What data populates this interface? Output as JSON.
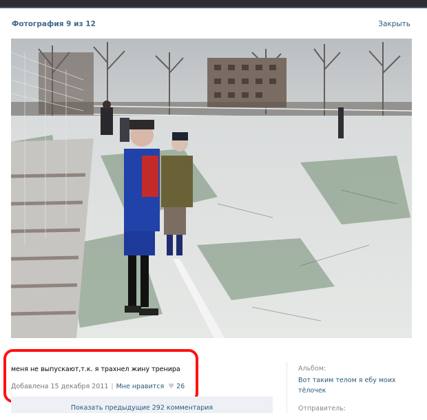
{
  "header": {
    "title": "Фотография 9 из 12",
    "close_label": "Закрыть"
  },
  "photo": {
    "alt_subject": "children-on-snowy-football-field"
  },
  "caption": {
    "text": "меня не выпускают,т.к. я трахнел жину тренира",
    "added_label": "Добавлена 15 декабря 2011",
    "like_label": "Мне нравится",
    "likes_count": "26"
  },
  "side": {
    "album_label": "Альбом:",
    "album_name": "Вот таким телом я ебу моих тёлочек",
    "sender_label": "Отправитель:"
  },
  "comments": {
    "show_previous": "Показать предыдущие 292 комментария"
  },
  "colors": {
    "link": "#2b587a",
    "title": "#45688e",
    "highlight": "#ff1010"
  }
}
